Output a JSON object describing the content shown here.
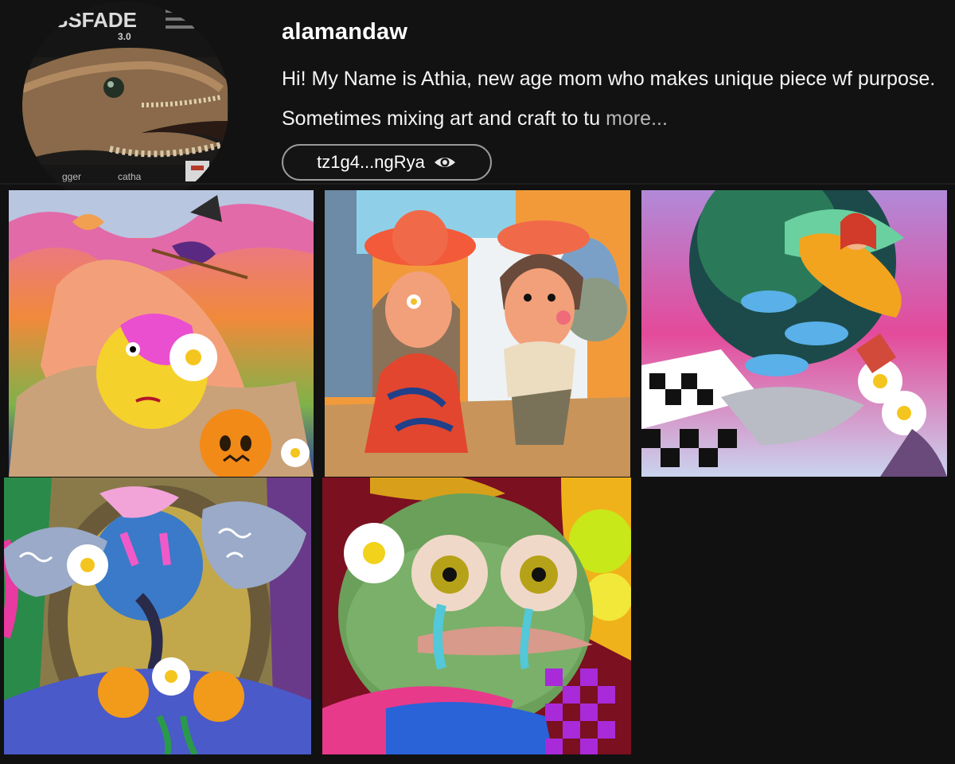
{
  "profile": {
    "username": "alamandaw",
    "bio_text": "Hi! My Name is Athia, new age mom who makes unique piece wf purpose. Sometimes mixing art and craft to tu",
    "bio_more": "more...",
    "wallet_address": "tz1g4...ngRya",
    "avatar_icon": "eel-portrait-avatar",
    "avatar_texts": [
      "SSFADE",
      "3.0",
      "gger",
      "catha"
    ]
  },
  "gallery": {
    "tiles": [
      {
        "icon": "witch-pumpkin-artwork"
      },
      {
        "icon": "two-girls-hats-artwork"
      },
      {
        "icon": "bird-girl-clouds-artwork"
      },
      {
        "icon": "mirror-face-daisies-artwork"
      },
      {
        "icon": "crying-frog-artwork"
      }
    ]
  },
  "colors": {
    "background": "#111111",
    "pill_border": "#9a9a9a",
    "more_link": "#b8b8b8"
  }
}
